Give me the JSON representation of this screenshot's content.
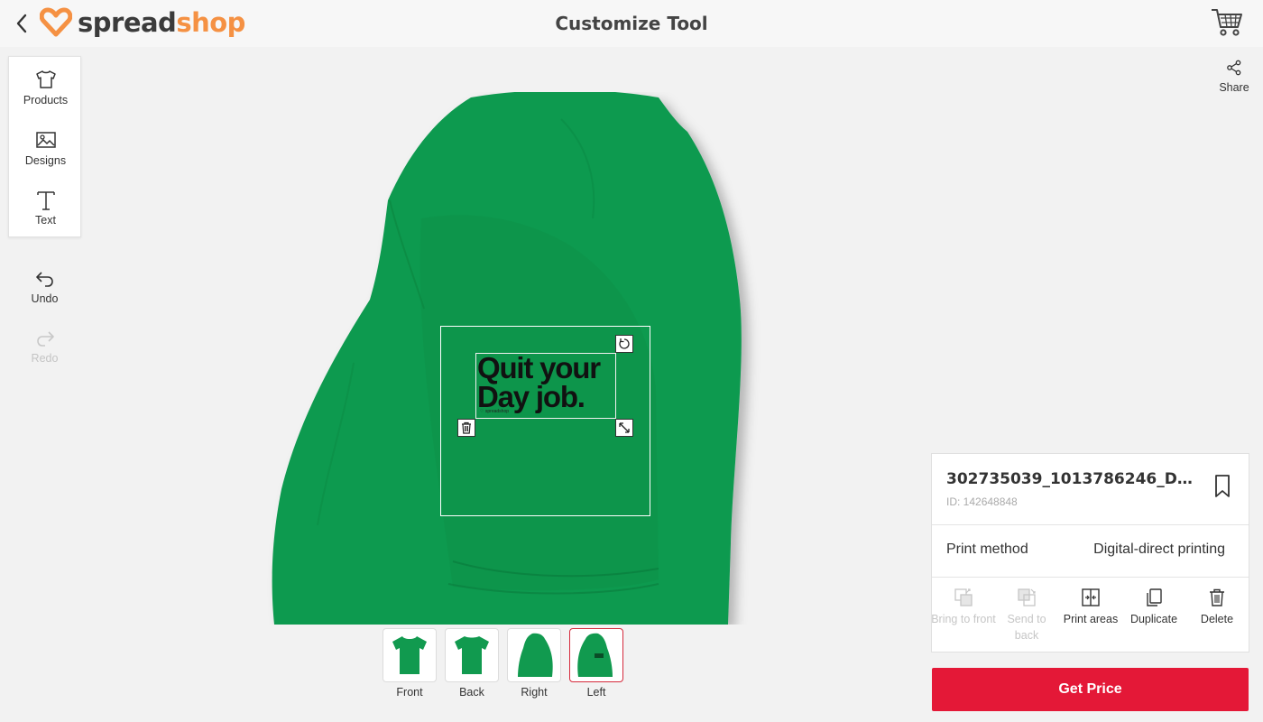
{
  "header": {
    "logo_part1": "spread",
    "logo_part2": "shop",
    "title": "Customize Tool"
  },
  "toolbar": {
    "products_label": "Products",
    "designs_label": "Designs",
    "text_label": "Text",
    "undo_label": "Undo",
    "redo_label": "Redo"
  },
  "share": {
    "label": "Share"
  },
  "design": {
    "line1": "Quit your",
    "line2": "Day job.",
    "brand": "♡ spreadshop"
  },
  "views": [
    {
      "label": "Front",
      "active": false
    },
    {
      "label": "Back",
      "active": false
    },
    {
      "label": "Right",
      "active": false
    },
    {
      "label": "Left",
      "active": true
    }
  ],
  "details": {
    "name": "302735039_1013786246_Da...",
    "id": "ID: 142648848",
    "print_method_label": "Print method",
    "print_method_value": "Digital-direct printing",
    "actions": {
      "bring_front": "Bring to front",
      "send_back": "Send to back",
      "print_areas": "Print areas",
      "duplicate": "Duplicate",
      "delete": "Delete"
    }
  },
  "cta": {
    "get_price": "Get Price"
  },
  "colors": {
    "shirt": "#119a4f",
    "accent_red": "#e41837",
    "logo_orange": "#f59143"
  },
  "icons": [
    "back-arrow-icon",
    "heart-logo-icon",
    "cart-icon",
    "tshirt-icon",
    "image-icon",
    "text-icon",
    "undo-icon",
    "redo-icon",
    "share-icon",
    "rotate-icon",
    "trash-icon",
    "resize-icon",
    "bookmark-icon",
    "bring-front-icon",
    "send-back-icon",
    "print-areas-icon",
    "duplicate-icon",
    "delete-icon"
  ]
}
